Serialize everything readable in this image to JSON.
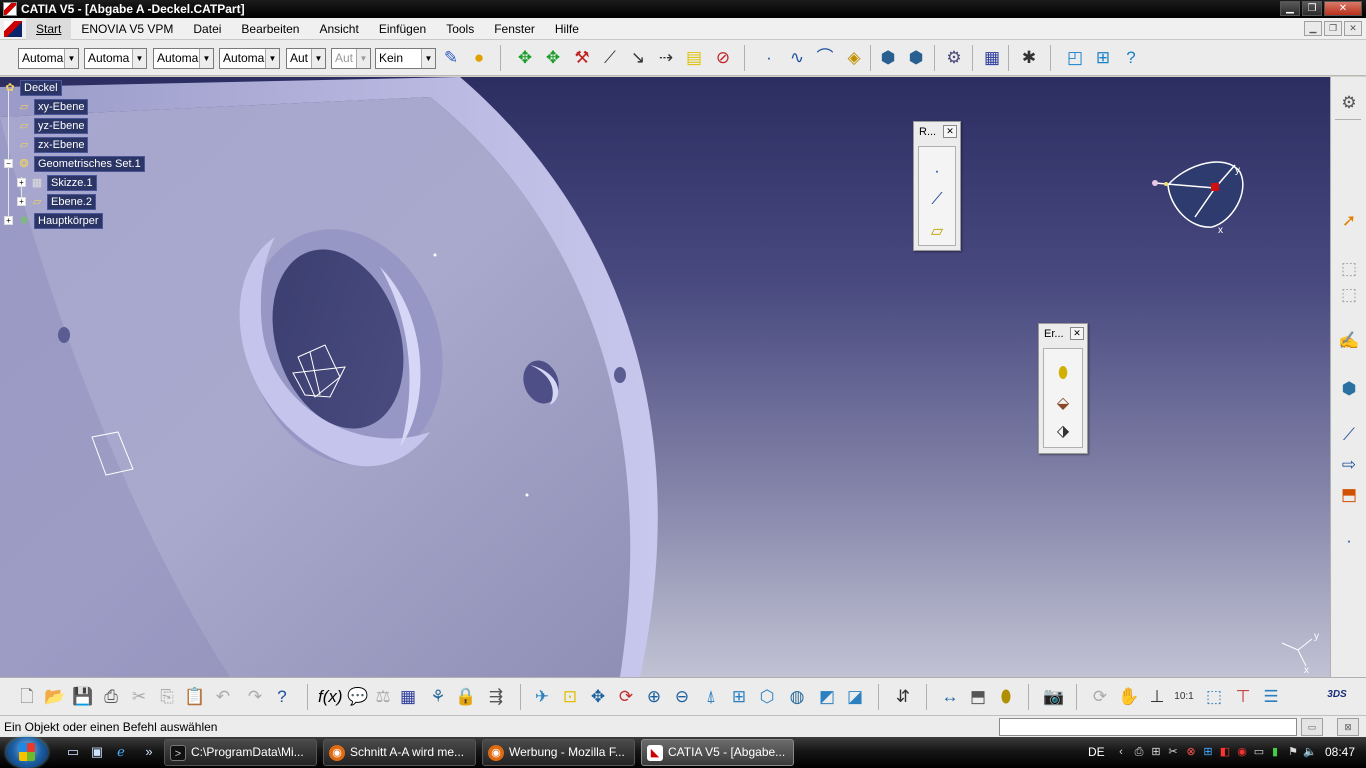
{
  "window": {
    "title": "CATIA V5 - [Abgabe A -Deckel.CATPart]"
  },
  "menubar": {
    "items": [
      "Start",
      "ENOVIA V5 VPM",
      "Datei",
      "Bearbeiten",
      "Ansicht",
      "Einfügen",
      "Tools",
      "Fenster",
      "Hilfe"
    ]
  },
  "toolbar_top": {
    "combos": [
      "Automa",
      "Automa",
      "Automa",
      "Automa",
      "Aut",
      "Aut",
      "Kein"
    ]
  },
  "tree": {
    "root": "Deckel",
    "items": [
      "xy-Ebene",
      "yz-Ebene",
      "zx-Ebene",
      "Geometrisches Set.1",
      "Skizze.1",
      "Ebene.2",
      "Hauptkörper"
    ]
  },
  "palettes": {
    "reference": {
      "title": "R..."
    },
    "extrude": {
      "title": "Er..."
    }
  },
  "compass": {
    "x_label": "x",
    "y_label": "y"
  },
  "axis_indicator": {
    "x_label": "x",
    "y_label": "y"
  },
  "statusbar": {
    "text": "Ein Objekt oder einen Befehl auswählen"
  },
  "taskbar": {
    "tasks": [
      "C:\\ProgramData\\Mi...",
      "Schnitt A-A wird me...",
      "Werbung - Mozilla F...",
      "CATIA V5 - [Abgabe..."
    ],
    "language": "DE",
    "clock": "08:47"
  },
  "colors": {
    "viewport_top": "#2c2e62",
    "viewport_bottom": "#c2c2d4",
    "part_fill": "#b8b8df",
    "tree_label_bg": "#2b3566"
  }
}
